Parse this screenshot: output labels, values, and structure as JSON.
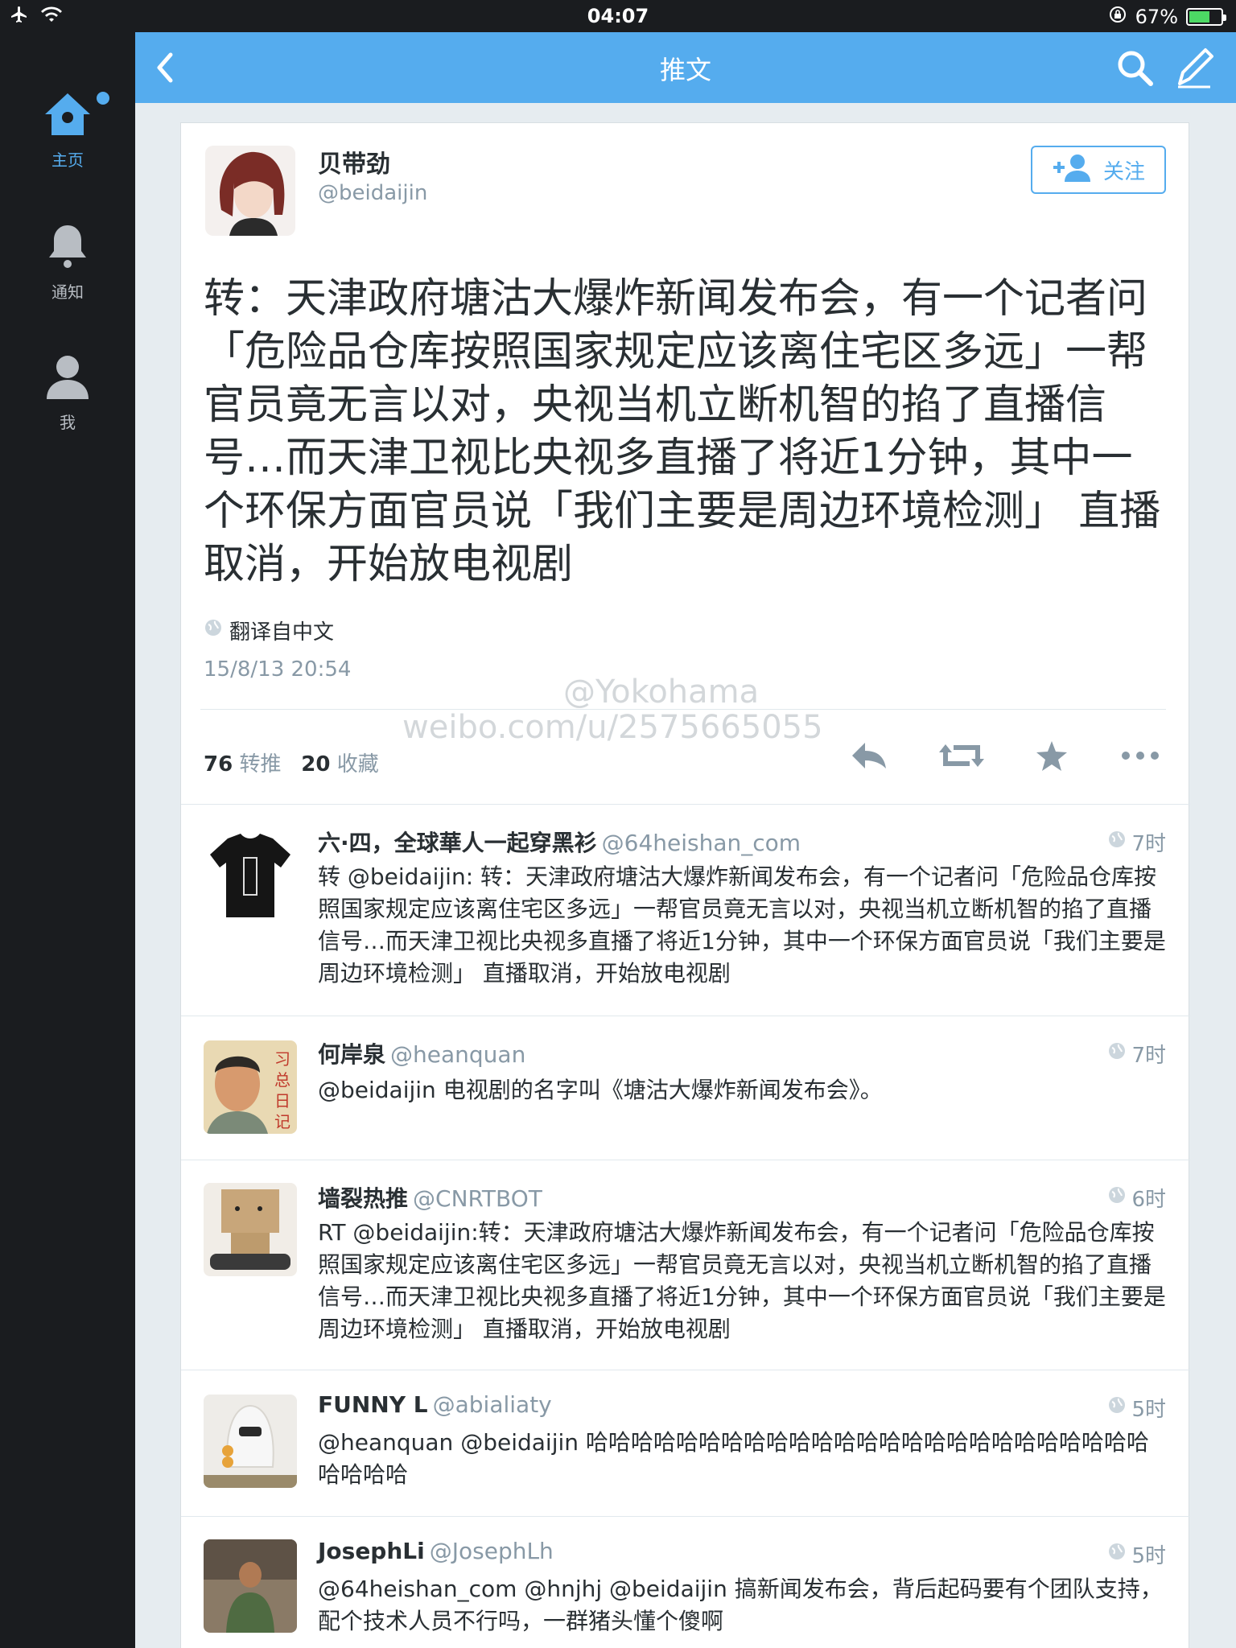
{
  "status_bar": {
    "time": "04:07",
    "battery": "67%",
    "battery_level": 0.67
  },
  "sidebar": {
    "items": [
      {
        "label": "主页",
        "icon": "home-icon"
      },
      {
        "label": "通知",
        "icon": "bell-icon"
      },
      {
        "label": "我",
        "icon": "user-icon"
      }
    ]
  },
  "header": {
    "title": "推文"
  },
  "tweet": {
    "name": "贝带劲",
    "handle": "@beidaijin",
    "follow_label": "关注",
    "text": "转：天津政府塘沽大爆炸新闻发布会，有一个记者问「危险品仓库按照国家规定应该离住宅区多远」一帮官员竟无言以对，央视当机立断机智的掐了直播信号…而天津卫视比央视多直播了将近1分钟，其中一个环保方面官员说「我们主要是周边环境检测」 直播取消，开始放电视剧",
    "translate_label": "翻译自中文",
    "timestamp": "15/8/13 20:54",
    "retweets": "76",
    "retweets_label": "转推",
    "favorites": "20",
    "favorites_label": "收藏"
  },
  "replies": [
    {
      "name": "六·四，全球華人一起穿黑衫",
      "handle": "@64heishan_com",
      "time": "7时",
      "text": "转 @beidaijin: 转：天津政府塘沽大爆炸新闻发布会，有一个记者问「危险品仓库按照国家规定应该离住宅区多远」一帮官员竟无言以对，央视当机立断机智的掐了直播信号…而天津卫视比央视多直播了将近1分钟，其中一个环保方面官员说「我们主要是周边环境检测」 直播取消，开始放电视剧"
    },
    {
      "name": "何岸泉",
      "handle": "@heanquan",
      "time": "7时",
      "text": "@beidaijin 电视剧的名字叫《塘沽大爆炸新闻发布会》。"
    },
    {
      "name": "墙裂热推",
      "handle": "@CNRTBOT",
      "time": "6时",
      "text": "RT @beidaijin:转：天津政府塘沽大爆炸新闻发布会，有一个记者问「危险品仓库按照国家规定应该离住宅区多远」一帮官员竟无言以对，央视当机立断机智的掐了直播信号…而天津卫视比央视多直播了将近1分钟，其中一个环保方面官员说「我们主要是周边环境检测」 直播取消，开始放电视剧"
    },
    {
      "name": "FUNNY L",
      "handle": "@abialiaty",
      "time": "5时",
      "text": "@heanquan @beidaijin 哈哈哈哈哈哈哈哈哈哈哈哈哈哈哈哈哈哈哈哈哈哈哈哈哈哈哈哈哈"
    },
    {
      "name": "JosephLi",
      "handle": "@JosephLh",
      "time": "5时",
      "text": "@64heishan_com @hnjhj @beidaijin 搞新闻发布会，背后起码要有个团队支持，配个技术人员不行吗，一群猪头懂个傻啊"
    }
  ],
  "watermark": {
    "line1": "@Yokohama",
    "line2": "weibo.com/u/2575665055"
  },
  "colors": {
    "accent": "#55acee",
    "sidebar": "#1a1c1f",
    "background": "#e6ecf0",
    "muted": "#8899a6"
  }
}
